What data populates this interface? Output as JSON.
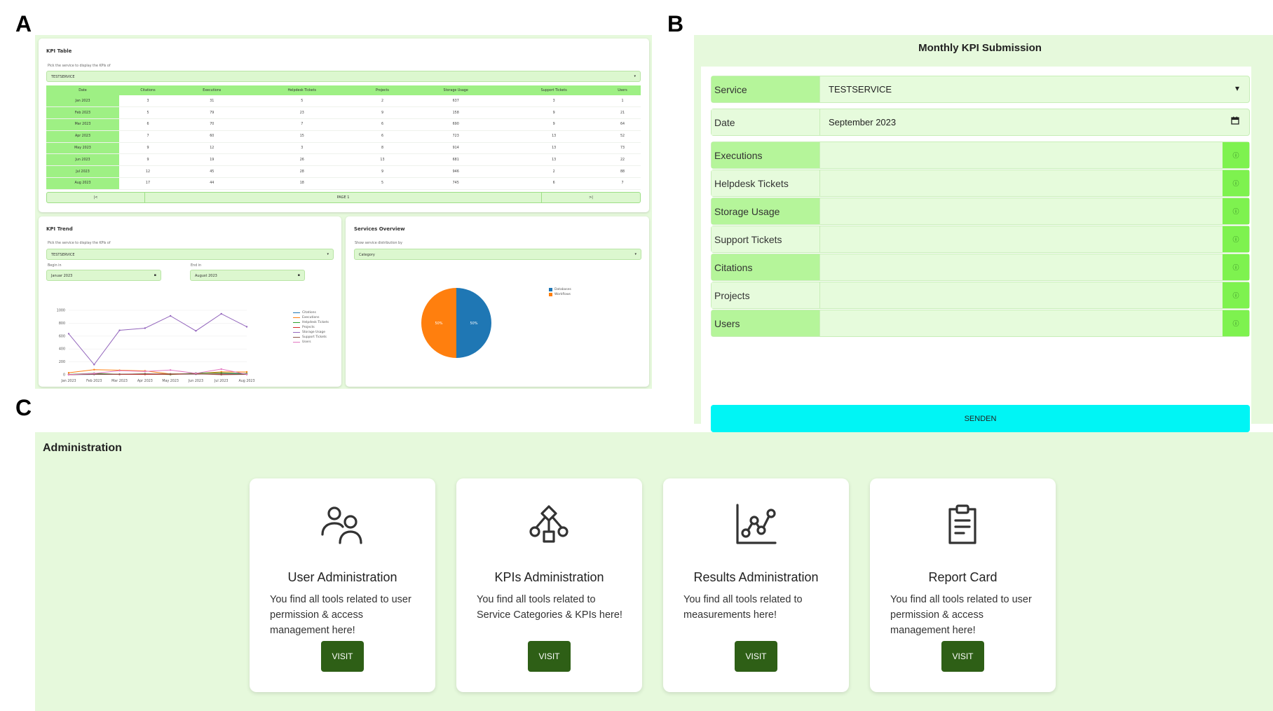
{
  "labels": {
    "a": "A",
    "b": "B",
    "c": "C"
  },
  "kpi_table": {
    "title": "KPI Table",
    "pick_label": "Pick the service to display the KPIs of",
    "service": "TESTSERVICE",
    "headers": [
      "Date",
      "Citations",
      "Executions",
      "Helpdesk Tickets",
      "Projects",
      "Storage Usage",
      "Support Tickets",
      "Users"
    ],
    "rows": [
      [
        "Jan 2023",
        "3",
        "31",
        "5",
        "2",
        "637",
        "3",
        "1"
      ],
      [
        "Feb 2023",
        "5",
        "79",
        "23",
        "9",
        "158",
        "9",
        "21"
      ],
      [
        "Mar 2023",
        "6",
        "70",
        "7",
        "6",
        "690",
        "9",
        "64"
      ],
      [
        "Apr 2023",
        "7",
        "60",
        "15",
        "6",
        "723",
        "13",
        "52"
      ],
      [
        "May 2023",
        "9",
        "12",
        "3",
        "8",
        "914",
        "13",
        "73"
      ],
      [
        "Jun 2023",
        "9",
        "19",
        "26",
        "13",
        "681",
        "13",
        "22"
      ],
      [
        "Jul 2023",
        "12",
        "45",
        "28",
        "9",
        "946",
        "2",
        "88"
      ],
      [
        "Aug 2023",
        "17",
        "44",
        "18",
        "5",
        "745",
        "6",
        "7"
      ]
    ],
    "pager": {
      "first": "|<",
      "page": "PAGE 1",
      "last": ">|"
    }
  },
  "kpi_trend": {
    "title": "KPI Trend",
    "pick_label": "Pick the service to display the KPIs of",
    "service": "TESTSERVICE",
    "begin_label": "Begin in",
    "begin_value": "Januar 2023",
    "end_label": "End in",
    "end_value": "August 2023",
    "chart_data": {
      "type": "line",
      "x": [
        "Jan 2023",
        "Feb 2023",
        "Mar 2023",
        "Apr 2023",
        "May 2023",
        "Jun 2023",
        "Jul 2023",
        "Aug 2023"
      ],
      "ylim": [
        0,
        1000
      ],
      "yticks": [
        "1000",
        "800",
        "600",
        "400",
        "200",
        "0"
      ],
      "series": [
        {
          "name": "Citations",
          "color": "#1f77b4",
          "values": [
            3,
            5,
            6,
            7,
            9,
            9,
            12,
            17
          ]
        },
        {
          "name": "Executions",
          "color": "#ff7f0e",
          "values": [
            31,
            79,
            70,
            60,
            12,
            19,
            45,
            44
          ]
        },
        {
          "name": "Helpdesk Tickets",
          "color": "#2ca02c",
          "values": [
            5,
            23,
            7,
            15,
            3,
            26,
            28,
            18
          ]
        },
        {
          "name": "Projects",
          "color": "#d62728",
          "values": [
            2,
            9,
            6,
            6,
            8,
            13,
            9,
            5
          ]
        },
        {
          "name": "Storage Usage",
          "color": "#9467bd",
          "values": [
            637,
            158,
            690,
            723,
            914,
            681,
            946,
            745
          ]
        },
        {
          "name": "Support Tickets",
          "color": "#8c564b",
          "values": [
            3,
            9,
            9,
            13,
            13,
            13,
            2,
            6
          ]
        },
        {
          "name": "Users",
          "color": "#e377c2",
          "values": [
            1,
            21,
            64,
            52,
            73,
            22,
            88,
            7
          ]
        }
      ]
    }
  },
  "services_overview": {
    "title": "Services Overview",
    "pick_label": "Show service distribution by",
    "select_value": "Category",
    "chart_data": {
      "type": "pie",
      "slices": [
        {
          "name": "Databases",
          "value": 50,
          "label": "50%",
          "color": "#1f77b4"
        },
        {
          "name": "Workflows",
          "value": 50,
          "label": "50%",
          "color": "#ff7f0e"
        }
      ]
    }
  },
  "form": {
    "title": "Monthly KPI Submission",
    "service_label": "Service",
    "service_value": "TESTSERVICE",
    "date_label": "Date",
    "date_value": "September 2023",
    "fields": [
      "Executions",
      "Helpdesk Tickets",
      "Storage Usage",
      "Support Tickets",
      "Citations",
      "Projects",
      "Users"
    ],
    "info_glyph": "ⓘ",
    "submit": "SENDEN"
  },
  "admin": {
    "title": "Administration",
    "cards": [
      {
        "title": "User Administration",
        "desc": "You find all tools related to user permission & access management here!",
        "button": "VISIT",
        "icon": "users-icon"
      },
      {
        "title": "KPIs Administration",
        "desc": "You find all tools related to Service Categories & KPIs here!",
        "button": "VISIT",
        "icon": "hierarchy-icon"
      },
      {
        "title": "Results Administration",
        "desc": "You find all tools related to measurements here!",
        "button": "VISIT",
        "icon": "chart-line-icon"
      },
      {
        "title": "Report Card",
        "desc": "You find all tools related to user permission & access management here!",
        "button": "VISIT",
        "icon": "clipboard-icon"
      }
    ]
  }
}
